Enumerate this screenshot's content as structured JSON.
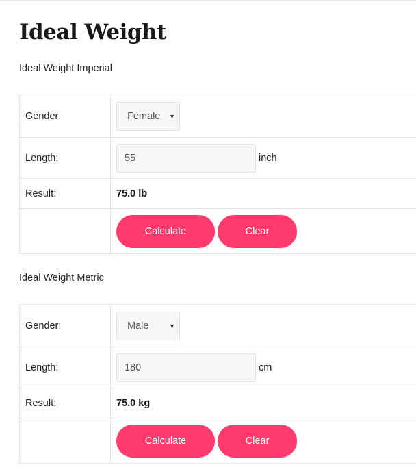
{
  "page": {
    "title": "Ideal Weight"
  },
  "imperial": {
    "heading": "Ideal Weight Imperial",
    "gender_label": "Gender:",
    "gender_value": "Female",
    "length_label": "Length:",
    "length_value": "55",
    "length_unit": "inch",
    "result_label": "Result:",
    "result_value": "75.0 lb",
    "calculate_label": "Calculate",
    "clear_label": "Clear"
  },
  "metric": {
    "heading": "Ideal Weight Metric",
    "gender_label": "Gender:",
    "gender_value": "Male",
    "length_label": "Length:",
    "length_value": "180",
    "length_unit": "cm",
    "result_label": "Result:",
    "result_value": "75.0 kg",
    "calculate_label": "Calculate",
    "clear_label": "Clear"
  },
  "icons": {
    "select_caret": "chevron-down-icon"
  },
  "colors": {
    "button": "#ff3b6e",
    "border": "#e4e4e4",
    "input_bg": "#f7f7f7"
  }
}
